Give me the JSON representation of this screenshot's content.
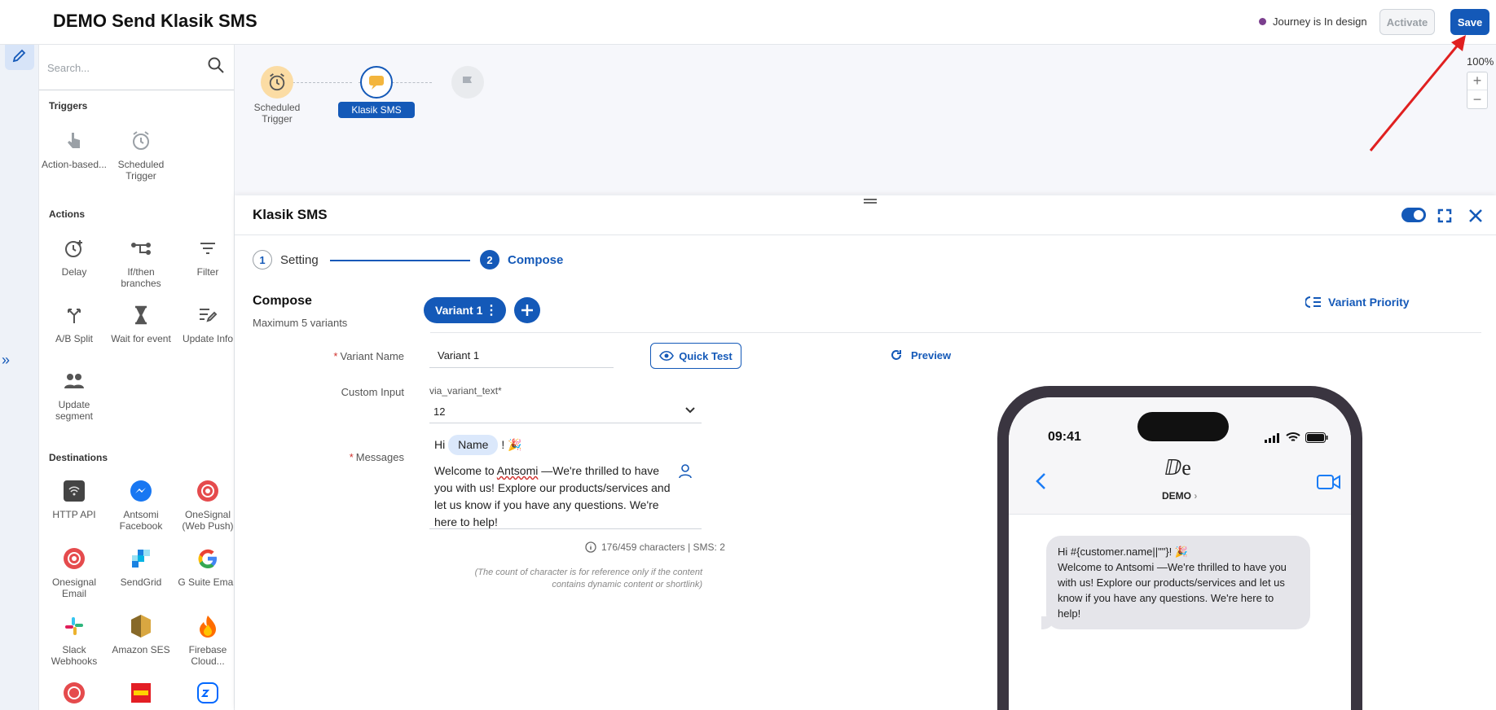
{
  "header": {
    "title": "DEMO Send Klasik SMS",
    "status_label": "Journey is In design",
    "activate_label": "Activate",
    "save_label": "Save"
  },
  "sidebar": {
    "search_placeholder": "Search...",
    "sections": {
      "triggers": "Triggers",
      "actions": "Actions",
      "destinations": "Destinations"
    },
    "triggers": [
      "Action-based...",
      "Scheduled Trigger"
    ],
    "actions": [
      "Delay",
      "If/then branches",
      "Filter",
      "A/B Split",
      "Wait for event",
      "Update Info",
      "Update segment"
    ],
    "destinations": [
      "HTTP API",
      "Antsomi Facebook",
      "OneSignal (Web Push)",
      "Onesignal Email",
      "SendGrid",
      "G Suite Email",
      "Slack Webhooks",
      "Amazon SES",
      "Firebase Cloud..."
    ]
  },
  "canvas": {
    "nodes": [
      "Scheduled Trigger",
      "Klasik SMS"
    ],
    "zoom": "100%"
  },
  "drawer": {
    "title": "Klasik SMS",
    "steps": [
      {
        "num": "1",
        "label": "Setting"
      },
      {
        "num": "2",
        "label": "Compose"
      }
    ],
    "compose_title": "Compose",
    "compose_sub": "Maximum 5 variants",
    "variant_tab": "Variant 1",
    "variant_priority": "Variant Priority",
    "variant_name_label": "Variant Name",
    "variant_name_value": "Variant 1",
    "quick_test": "Quick Test",
    "preview": "Preview",
    "custom_input_label": "Custom Input",
    "custom_input_name": "via_variant_text*",
    "custom_input_value": "12",
    "messages_label": "Messages",
    "message": {
      "hi": "Hi",
      "tag": "Name",
      "excl": "!",
      "emoji": "🎉",
      "p1": "Welcome to",
      "antsomi": "Antsomi",
      "p2": "—We're thrilled to have you with us! Explore our products/services and let us know if you have any questions. We're here to help!"
    },
    "count": "176/459 characters | SMS: 2",
    "note": "(The count of character is for reference only if the content contains dynamic content or shortlink)"
  },
  "phone": {
    "time": "09:41",
    "contact": "DEMO",
    "bubble_line1": "Hi #{customer.name||\"\"}! 🎉",
    "bubble_line2": "Welcome to Antsomi —We're thrilled to have you with us! Explore our products/services and let us know if you have any questions. We're here to help!"
  },
  "colors": {
    "primary": "#1459b8",
    "status_dot": "#7b3f8e",
    "required": "#d0312d",
    "annotation_arrow": "#e02020"
  }
}
